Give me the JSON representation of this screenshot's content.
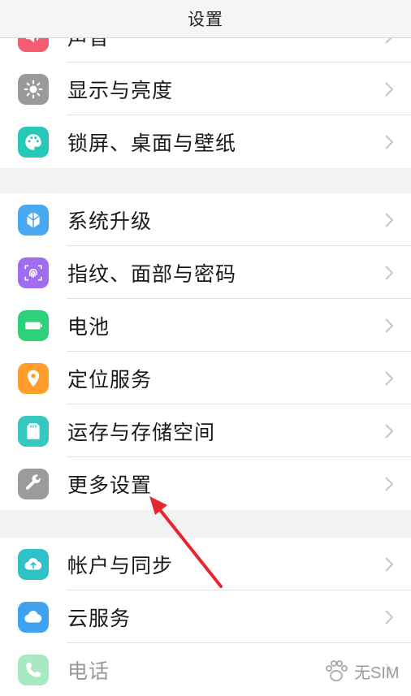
{
  "header": {
    "title": "设置"
  },
  "colors": {
    "sound": "#f25d72",
    "display": "#9a9a9a",
    "wallpaper": "#27c8b8",
    "upgrade": "#4aa8f0",
    "fingerprint": "#a06cf0",
    "battery": "#2fd07a",
    "location": "#ff9e2c",
    "storage": "#33c9c0",
    "more": "#9b9b9b",
    "account": "#2ec2c6",
    "cloud": "#3fa2f0",
    "phone": "#3ccf7c",
    "arrow": "#e8262e"
  },
  "groups": [
    {
      "items": [
        {
          "label": "声音",
          "icon": "sound-icon"
        },
        {
          "label": "显示与亮度",
          "icon": "brightness-icon"
        },
        {
          "label": "锁屏、桌面与壁纸",
          "icon": "palette-icon"
        }
      ]
    },
    {
      "items": [
        {
          "label": "系统升级",
          "icon": "upgrade-icon"
        },
        {
          "label": "指纹、面部与密码",
          "icon": "fingerprint-icon"
        },
        {
          "label": "电池",
          "icon": "battery-icon"
        },
        {
          "label": "定位服务",
          "icon": "location-icon"
        },
        {
          "label": "运存与存储空间",
          "icon": "storage-icon"
        },
        {
          "label": "更多设置",
          "icon": "wrench-icon"
        }
      ]
    },
    {
      "items": [
        {
          "label": "帐户与同步",
          "icon": "cloud-sync-icon"
        },
        {
          "label": "云服务",
          "icon": "cloud-icon"
        },
        {
          "label": "电话",
          "icon": "phone-icon"
        }
      ]
    }
  ],
  "watermark": {
    "text": "无SIM"
  }
}
